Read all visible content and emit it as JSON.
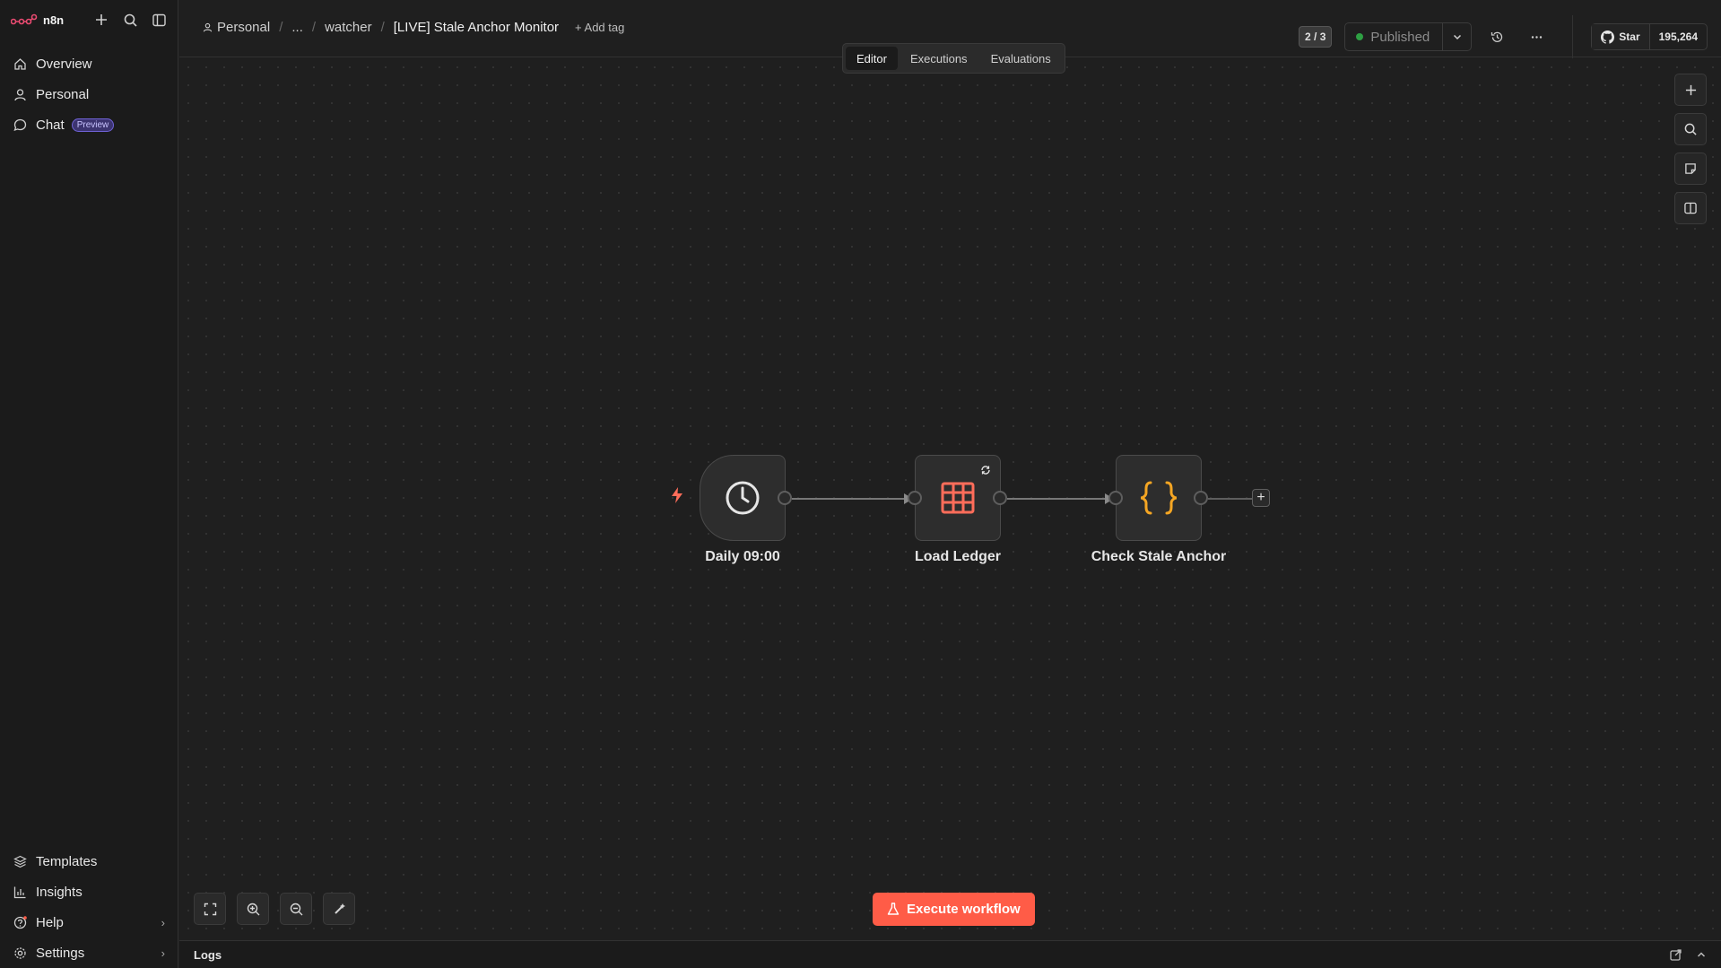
{
  "app": {
    "name": "n8n"
  },
  "sidebar": {
    "items": [
      {
        "label": "Overview",
        "icon": "home-icon"
      },
      {
        "label": "Personal",
        "icon": "user-icon"
      },
      {
        "label": "Chat",
        "icon": "chat-icon",
        "badge": "Preview"
      }
    ],
    "bottom_items": [
      {
        "label": "Templates",
        "icon": "templates-icon"
      },
      {
        "label": "Insights",
        "icon": "insights-icon"
      },
      {
        "label": "Help",
        "icon": "help-icon"
      },
      {
        "label": "Settings",
        "icon": "gear-icon"
      }
    ]
  },
  "breadcrumb": {
    "project": "Personal",
    "ellipsis": "...",
    "folder": "watcher",
    "workflow": "[LIVE] Stale Anchor Monitor",
    "add_tag": "+ Add tag"
  },
  "header": {
    "version_counter": "2 / 3",
    "publish_label": "Published",
    "github_star": "Star",
    "github_count": "195,264"
  },
  "tabs": [
    {
      "label": "Editor",
      "active": true
    },
    {
      "label": "Executions",
      "active": false
    },
    {
      "label": "Evaluations",
      "active": false
    }
  ],
  "nodes": [
    {
      "label": "Daily 09:00",
      "icon": "clock-icon",
      "type": "trigger"
    },
    {
      "label": "Load Ledger",
      "icon": "table-icon",
      "type": "action"
    },
    {
      "label": "Check Stale Anchor",
      "icon": "code-braces-icon",
      "type": "action"
    }
  ],
  "execute_button": "Execute workflow",
  "logs": {
    "label": "Logs"
  },
  "colors": {
    "accent": "#ff5c47",
    "published_dot": "#2ea043",
    "table_icon": "#ff6d5a",
    "code_icon": "#f5a623"
  }
}
